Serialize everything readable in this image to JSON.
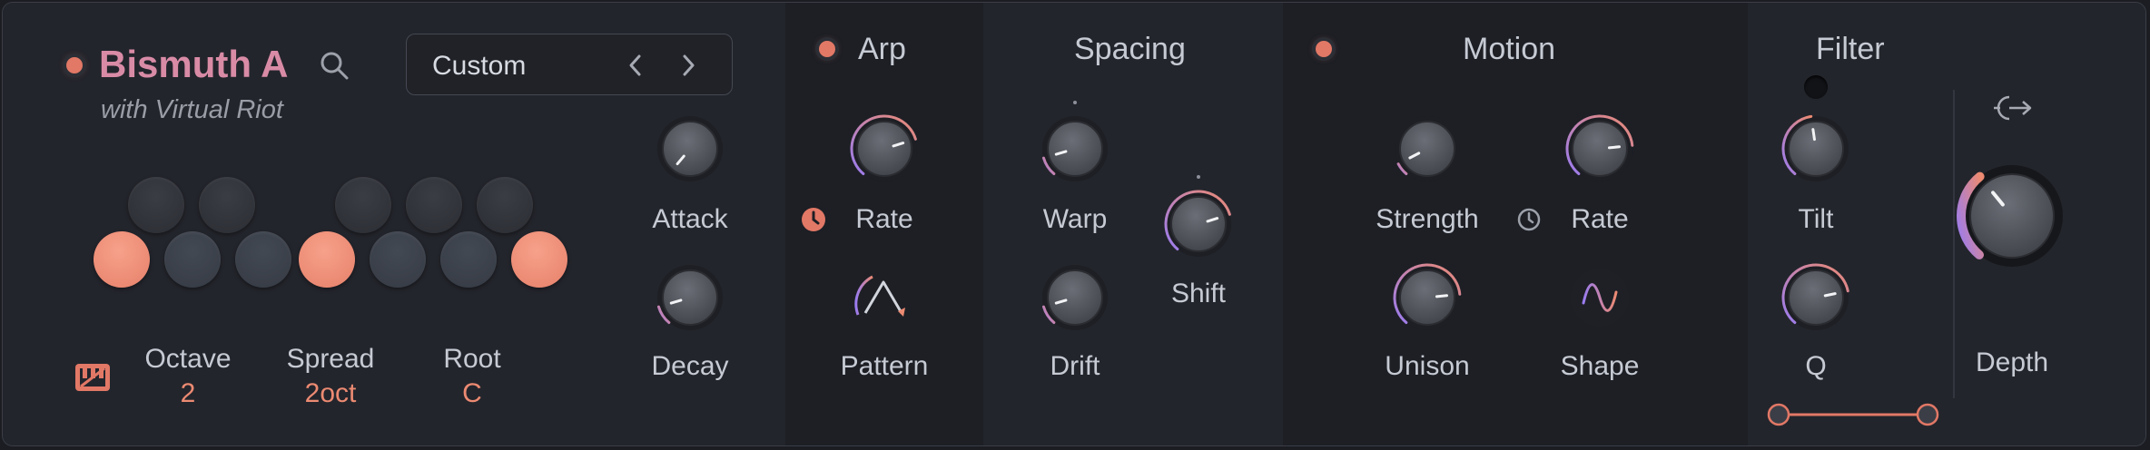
{
  "header": {
    "title": "Bismuth A",
    "subtitle": "with Virtual Riot",
    "preset": "Custom"
  },
  "main": {
    "octave_label": "Octave",
    "octave_value": "2",
    "spread_label": "Spread",
    "spread_value": "2oct",
    "root_label": "Root",
    "root_value": "C",
    "attack_label": "Attack",
    "decay_label": "Decay"
  },
  "arp": {
    "title": "Arp",
    "rate_label": "Rate",
    "pattern_label": "Pattern"
  },
  "spacing": {
    "title": "Spacing",
    "warp_label": "Warp",
    "shift_label": "Shift",
    "drift_label": "Drift"
  },
  "motion": {
    "title": "Motion",
    "strength_label": "Strength",
    "rate_label": "Rate",
    "unison_label": "Unison",
    "shape_label": "Shape"
  },
  "filter": {
    "title": "Filter",
    "tilt_label": "Tilt",
    "q_label": "Q",
    "depth_label": "Depth"
  },
  "colors": {
    "accent": "#e27866",
    "title": "#d98ba6",
    "value": "#ec8a72",
    "ring_start": "#9a7cf0",
    "ring_end": "#ec8a72"
  }
}
